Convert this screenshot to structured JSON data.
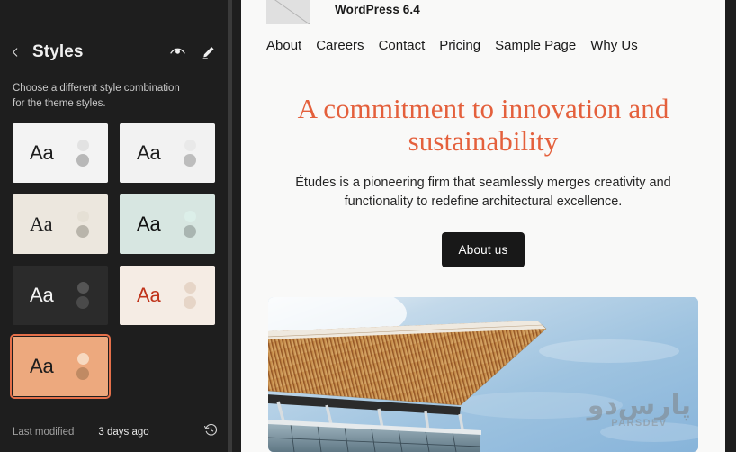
{
  "sidebar": {
    "back_icon": "chevron-left-icon",
    "title": "Styles",
    "actions": [
      {
        "name": "preview-icon",
        "label": "Style Book"
      },
      {
        "name": "pencil-icon",
        "label": "Edit styles"
      }
    ],
    "description": "Choose a different style combination for the theme styles.",
    "variations": [
      {
        "id": "default-light",
        "aa": "Aa",
        "bg": "#f3f3f3",
        "text": "#1d1d1d",
        "font": "sans",
        "dot_top": "#e2e2e2",
        "dot_bottom": "#b8b8b8",
        "selected": false
      },
      {
        "id": "grey-light",
        "aa": "Aa",
        "bg": "#f2f2f2",
        "text": "#1d1d1d",
        "font": "sans",
        "dot_top": "#e9e9e9",
        "dot_bottom": "#bdbdbd",
        "selected": false
      },
      {
        "id": "cream-serif",
        "aa": "Aa",
        "bg": "#ece7de",
        "text": "#1d1d1d",
        "font": "serif",
        "dot_top": "#e5e0d5",
        "dot_bottom": "#b9b5ab",
        "selected": false
      },
      {
        "id": "mint",
        "aa": "Aa",
        "bg": "#d7e6e1",
        "text": "#121212",
        "font": "sans",
        "dot_top": "#dcefe9",
        "dot_bottom": "#a9b5b1",
        "selected": false
      },
      {
        "id": "dark",
        "aa": "Aa",
        "bg": "#2b2b2b",
        "text": "#f4f4f4",
        "font": "sans",
        "dot_top": "#555555",
        "dot_bottom": "#4a4a4a",
        "selected": false
      },
      {
        "id": "ivory-red",
        "aa": "Aa",
        "bg": "#f5ece4",
        "text": "#c0341b",
        "font": "sans",
        "dot_top": "#e6d5c7",
        "dot_bottom": "#e6d5c7",
        "selected": false
      },
      {
        "id": "peach",
        "aa": "Aa",
        "bg": "#eda97e",
        "text": "#1d1d1d",
        "font": "sans",
        "dot_top": "#f7d9c0",
        "dot_bottom": "#c08a63",
        "selected": true
      }
    ],
    "footer": {
      "last_modified_label": "Last modified",
      "last_modified_value": "3 days ago",
      "history_icon": "clock-history-icon"
    }
  },
  "canvas": {
    "site": {
      "logo_placeholder": "broken-image-icon",
      "brand": "WordPress 6.4",
      "nav": [
        {
          "label": "About"
        },
        {
          "label": "Careers"
        },
        {
          "label": "Contact"
        },
        {
          "label": "Pricing"
        },
        {
          "label": "Sample Page"
        },
        {
          "label": "Why Us"
        }
      ],
      "hero": {
        "title": "A commitment to innovation and sustainability",
        "title_color": "#e4603c",
        "subtitle": "Études is a pioneering firm that seamlessly merges creativity and functionality to redefine architectural excellence.",
        "cta_label": "About us",
        "cta_bg": "#181818"
      },
      "media": {
        "alt": "architectural-canopy-photo",
        "watermark_fa": "پارس‌دو",
        "watermark_en": "PARSDEV"
      }
    }
  }
}
